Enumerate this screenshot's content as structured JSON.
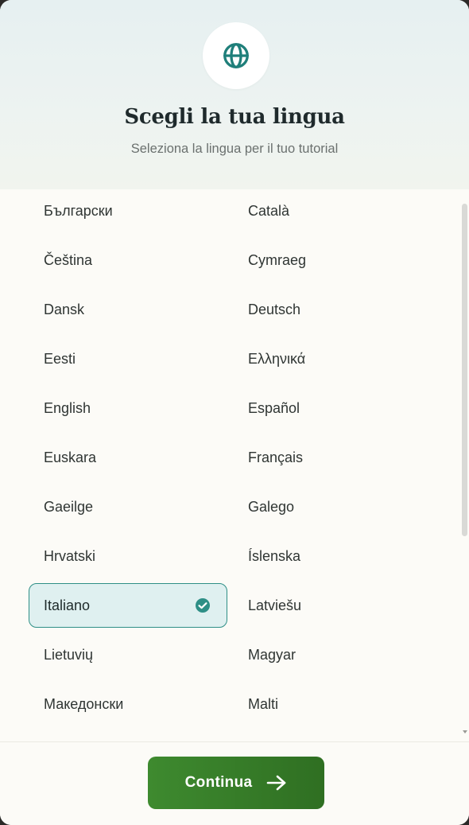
{
  "header": {
    "icon": "globe-icon",
    "title": "Scegli la tua lingua",
    "subtitle": "Seleziona la lingua per il tuo tutorial"
  },
  "languages": [
    {
      "label": "Български",
      "selected": false
    },
    {
      "label": "Català",
      "selected": false
    },
    {
      "label": "Čeština",
      "selected": false
    },
    {
      "label": "Cymraeg",
      "selected": false
    },
    {
      "label": "Dansk",
      "selected": false
    },
    {
      "label": "Deutsch",
      "selected": false
    },
    {
      "label": "Eesti",
      "selected": false
    },
    {
      "label": "Ελληνικά",
      "selected": false
    },
    {
      "label": "English",
      "selected": false
    },
    {
      "label": "Español",
      "selected": false
    },
    {
      "label": "Euskara",
      "selected": false
    },
    {
      "label": "Français",
      "selected": false
    },
    {
      "label": "Gaeilge",
      "selected": false
    },
    {
      "label": "Galego",
      "selected": false
    },
    {
      "label": "Hrvatski",
      "selected": false
    },
    {
      "label": "Íslenska",
      "selected": false
    },
    {
      "label": "Italiano",
      "selected": true
    },
    {
      "label": "Latviešu",
      "selected": false
    },
    {
      "label": "Lietuvių",
      "selected": false
    },
    {
      "label": "Magyar",
      "selected": false
    },
    {
      "label": "Македонски",
      "selected": false
    },
    {
      "label": "Malti",
      "selected": false
    }
  ],
  "footer": {
    "continue_label": "Continua",
    "continue_icon": "arrow-right-icon"
  },
  "colors": {
    "accent": "#2e8f86",
    "selected_bg": "#dff0f0",
    "button": "#357a28"
  }
}
